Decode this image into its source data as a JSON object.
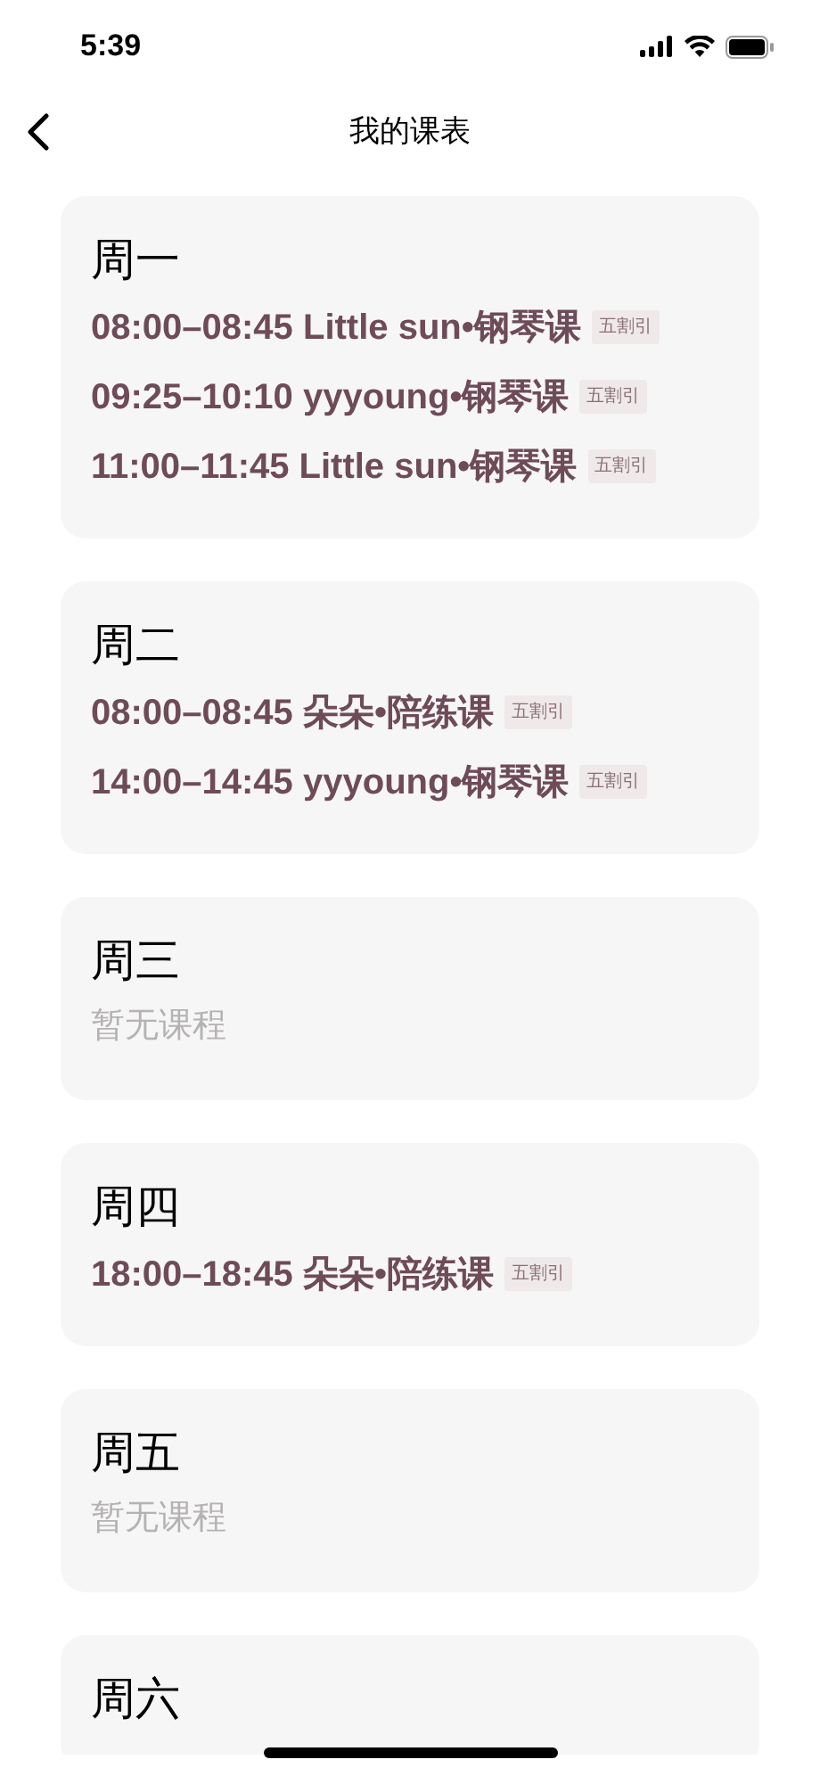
{
  "status_bar": {
    "time": "5:39"
  },
  "nav": {
    "title": "我的课表"
  },
  "days": [
    {
      "day": "周一",
      "lessons": [
        {
          "text": "08:00–08:45 Little sun•钢琴课",
          "tag": "五割引"
        },
        {
          "text": "09:25–10:10 yyyoung•钢琴课",
          "tag": "五割引"
        },
        {
          "text": "11:00–11:45 Little sun•钢琴课",
          "tag": "五割引"
        }
      ]
    },
    {
      "day": "周二",
      "lessons": [
        {
          "text": "08:00–08:45 朵朵•陪练课",
          "tag": "五割引"
        },
        {
          "text": "14:00–14:45 yyyoung•钢琴课",
          "tag": "五割引"
        }
      ]
    },
    {
      "day": "周三",
      "empty_text": "暂无课程"
    },
    {
      "day": "周四",
      "lessons": [
        {
          "text": "18:00–18:45 朵朵•陪练课",
          "tag": "五割引"
        }
      ]
    },
    {
      "day": "周五",
      "empty_text": "暂无课程"
    },
    {
      "day": "周六"
    }
  ]
}
